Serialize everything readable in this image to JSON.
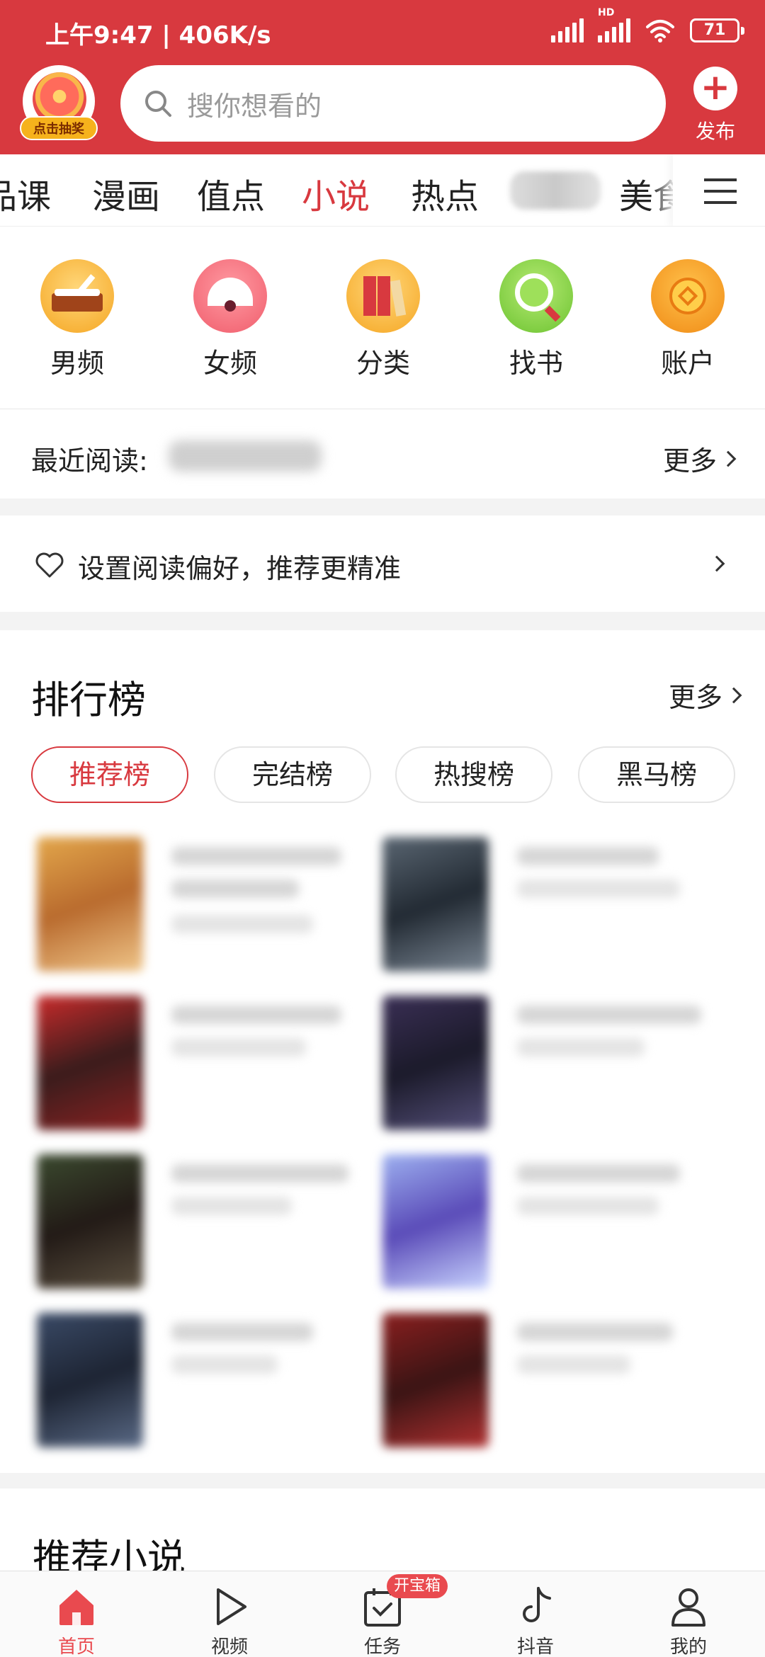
{
  "status_bar": {
    "time": "上午9:47 | 406K/s",
    "battery": "71",
    "network_hd": "HD"
  },
  "header": {
    "lottery_label": "点击抽奖",
    "search_placeholder": "搜你想看的",
    "publish_label": "发布",
    "publish_icon": "+",
    "bg_color": "#d8393f"
  },
  "channel_tabs": [
    {
      "label": "品课",
      "active": false
    },
    {
      "label": "漫画",
      "active": false
    },
    {
      "label": "值点",
      "active": false
    },
    {
      "label": "小说",
      "active": true
    },
    {
      "label": "热点",
      "active": false
    },
    {
      "label": "美食",
      "active": false
    }
  ],
  "categories": [
    {
      "label": "男频",
      "icon": "drum-icon"
    },
    {
      "label": "女频",
      "icon": "fan-icon"
    },
    {
      "label": "分类",
      "icon": "books-icon"
    },
    {
      "label": "找书",
      "icon": "magnifier-icon"
    },
    {
      "label": "账户",
      "icon": "coin-icon"
    }
  ],
  "recent": {
    "label": "最近阅读:",
    "more": "更多"
  },
  "preference": {
    "text": "设置阅读偏好，推荐更精准"
  },
  "ranking": {
    "title": "排行榜",
    "more": "更多",
    "tabs": [
      {
        "label": "推荐榜",
        "active": true
      },
      {
        "label": "完结榜",
        "active": false
      },
      {
        "label": "热搜榜",
        "active": false
      },
      {
        "label": "黑马榜",
        "active": false
      }
    ]
  },
  "recommended": {
    "title": "推荐小说"
  },
  "bottom_nav": [
    {
      "label": "首页",
      "icon": "home-icon",
      "active": true
    },
    {
      "label": "视频",
      "icon": "play-icon",
      "active": false
    },
    {
      "label": "任务",
      "icon": "task-icon",
      "active": false,
      "badge": "开宝箱"
    },
    {
      "label": "抖音",
      "icon": "douyin-icon",
      "active": false
    },
    {
      "label": "我的",
      "icon": "profile-icon",
      "active": false
    }
  ],
  "accent_color": "#d8393f"
}
